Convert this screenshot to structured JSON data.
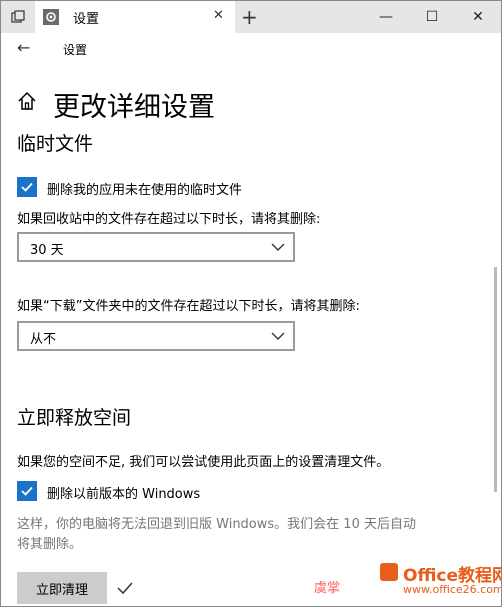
{
  "tab": {
    "title": "设置",
    "close": "✕"
  },
  "toolbar": {
    "new_tab": "+"
  },
  "window_controls": {
    "minimize": "—",
    "maximize": "☐",
    "close": "✕"
  },
  "nav": {
    "back": "←",
    "breadcrumb": "设置"
  },
  "page": {
    "title": "更改详细设置"
  },
  "temp_files": {
    "section_title": "临时文件",
    "delete_unused_label": "删除我的应用未在使用的临时文件",
    "delete_unused_checked": true,
    "recycle_prompt": "如果回收站中的文件存在超过以下时长，请将其删除:",
    "recycle_value": "30 天",
    "downloads_prompt": "如果“下载”文件夹中的文件存在超过以下时长，请将其删除:",
    "downloads_value": "从不"
  },
  "free_space": {
    "section_title": "立即释放空间",
    "description": "如果您的空间不足, 我们可以尝试使用此页面上的设置清理文件。",
    "delete_windows_label": "删除以前版本的 Windows",
    "delete_windows_checked": true,
    "warning_line1": "这样，你的电脑将无法回退到旧版 Windows。我们会在 10 天后自动",
    "warning_line2": "将其删除。",
    "clean_button": "立即清理"
  },
  "watermark": {
    "left": "虞掌",
    "brand": "Office教程网",
    "url": "www.office26.com"
  },
  "colors": {
    "accent": "#1a73c9",
    "title_bar": "#e6e6e6",
    "button": "#cccccc",
    "watermark": "#e85d1c"
  }
}
